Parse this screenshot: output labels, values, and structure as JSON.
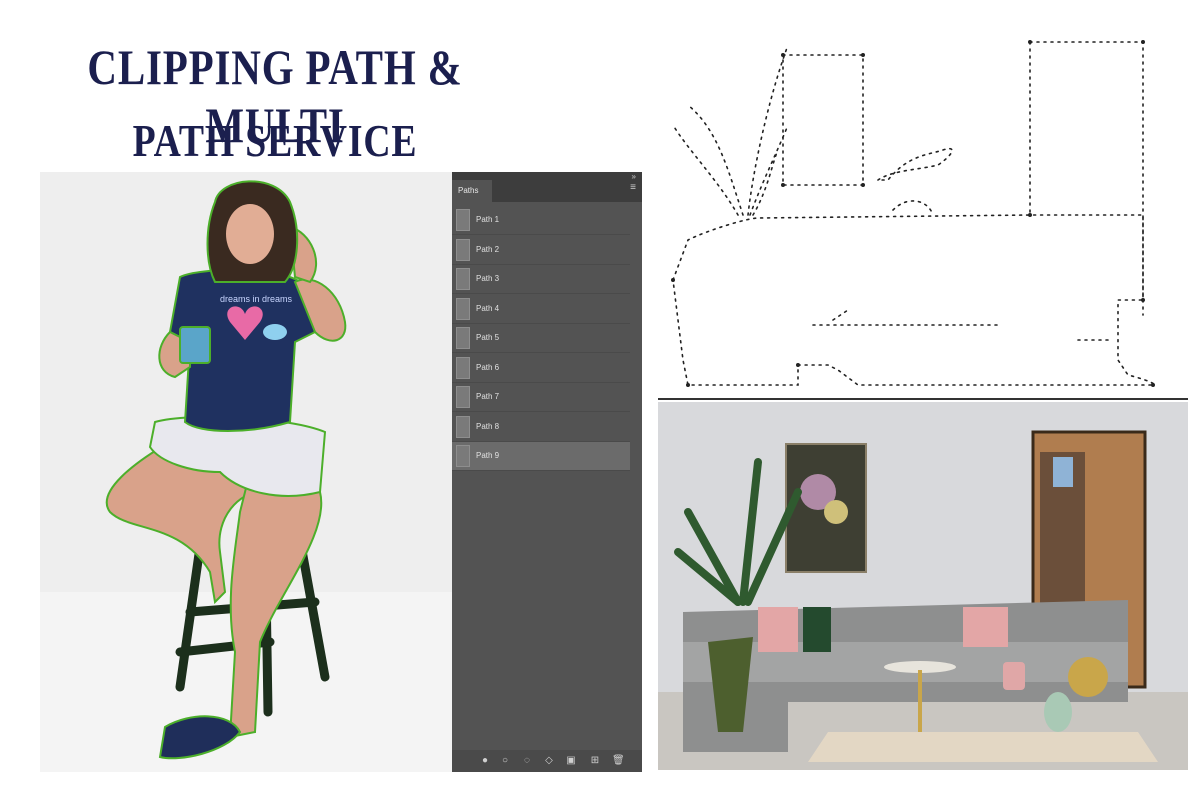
{
  "title": {
    "line1": "CLIPPING PATH & MULTI",
    "line2": "PATH SERVICE"
  },
  "paths_panel": {
    "tab_label": "Paths",
    "items": [
      {
        "label": "Path 1"
      },
      {
        "label": "Path 2"
      },
      {
        "label": "Path 3"
      },
      {
        "label": "Path 4"
      },
      {
        "label": "Path 5"
      },
      {
        "label": "Path 6"
      },
      {
        "label": "Path 7"
      },
      {
        "label": "Path 8"
      },
      {
        "label": "Path 9"
      }
    ],
    "selected_index": 8
  },
  "tshirt_print": "dreams in dreams",
  "colors": {
    "title": "#1b1f4e",
    "panel_bg": "#535353",
    "clip_outline": "#4caf2a"
  }
}
